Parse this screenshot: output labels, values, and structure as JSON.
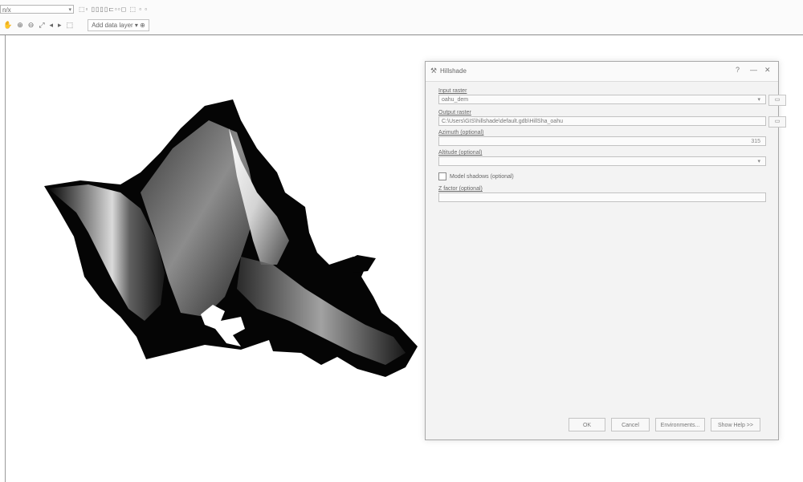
{
  "toolbar": {
    "combo_value": "n/x",
    "combo_chevron": "▾",
    "row1_icons_text": "⬚▫ ▯▯▯▯⊏▫▫◻ ⬚ ▫ ▫",
    "row2_icons": [
      "pan-icon",
      "zoom-in-icon",
      "zoom-out-icon",
      "full-extent-icon",
      "back-icon",
      "forward-icon",
      "identify-icon"
    ],
    "row2_glyphs": [
      "✋",
      "⊕",
      "⊖",
      "⤢",
      "◂",
      "▸",
      "⬚"
    ],
    "dropdown_label": "Add data layer ▾  ⊕"
  },
  "dialog": {
    "title": "Hillshade",
    "title_icon": "hammer-icon",
    "title_glyph": "⚒",
    "help_glyph": "?",
    "close_glyph": "✕",
    "min_glyph": "—",
    "fields": {
      "input_raster_label": "Input raster",
      "input_raster_value": "oahu_dem",
      "input_raster_side": "▭",
      "output_raster_label": "Output raster",
      "output_raster_value": "C:\\Users\\GIS\\hillshade\\default.gdb\\HillSha_oahu",
      "output_raster_side": "▭",
      "azimuth_label": "Azimuth (optional)",
      "azimuth_side": "315",
      "altitude_label": "Altitude (optional)",
      "altitude_chevron": "▾",
      "model_shadows_label": "Model shadows (optional)",
      "z_factor_label": "Z factor (optional)"
    },
    "buttons": {
      "ok": "OK",
      "cancel": "Cancel",
      "environments": "Environments...",
      "show_help": "Show Help >>"
    }
  },
  "colors": {
    "toolbar_bg": "#fbfbfb",
    "dialog_bg": "#f3f3f3",
    "dialog_border": "#a8a8a8"
  }
}
